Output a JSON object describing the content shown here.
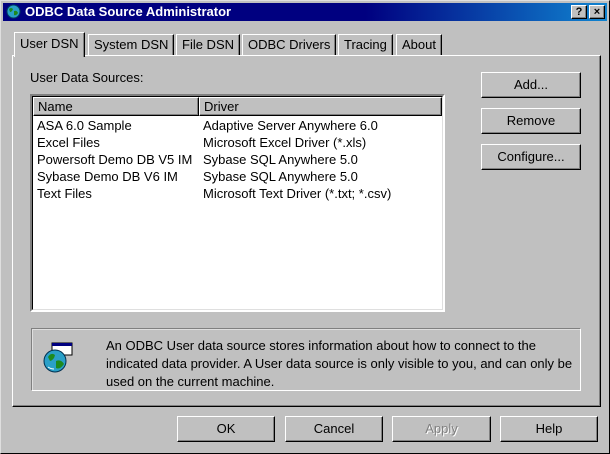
{
  "window": {
    "title": "ODBC Data Source Administrator",
    "help_button": "?",
    "close_button": "×"
  },
  "tabs": [
    {
      "label": "User DSN",
      "active": true
    },
    {
      "label": "System DSN"
    },
    {
      "label": "File DSN"
    },
    {
      "label": "ODBC Drivers"
    },
    {
      "label": "Tracing"
    },
    {
      "label": "About"
    }
  ],
  "panel": {
    "list_label": "User Data Sources:",
    "columns": [
      "Name",
      "Driver"
    ],
    "rows": [
      {
        "name": "ASA 6.0 Sample",
        "driver": "Adaptive Server Anywhere 6.0"
      },
      {
        "name": "Excel Files",
        "driver": "Microsoft Excel Driver (*.xls)"
      },
      {
        "name": "Powersoft Demo DB V5 IM",
        "driver": "Sybase SQL Anywhere 5.0"
      },
      {
        "name": "Sybase Demo DB V6 IM",
        "driver": "Sybase SQL Anywhere 5.0"
      },
      {
        "name": "Text Files",
        "driver": "Microsoft Text Driver (*.txt; *.csv)"
      }
    ],
    "buttons": {
      "add": "Add...",
      "remove": "Remove",
      "configure": "Configure..."
    },
    "info_text": "An ODBC User data source stores information about how to connect to the indicated data provider.  A User data source is only visible to you, and can only be used on the current machine."
  },
  "footer": {
    "ok": "OK",
    "cancel": "Cancel",
    "apply": "Apply",
    "help": "Help"
  },
  "colors": {
    "titlebar": "#000080",
    "face": "#c0c0c0"
  }
}
